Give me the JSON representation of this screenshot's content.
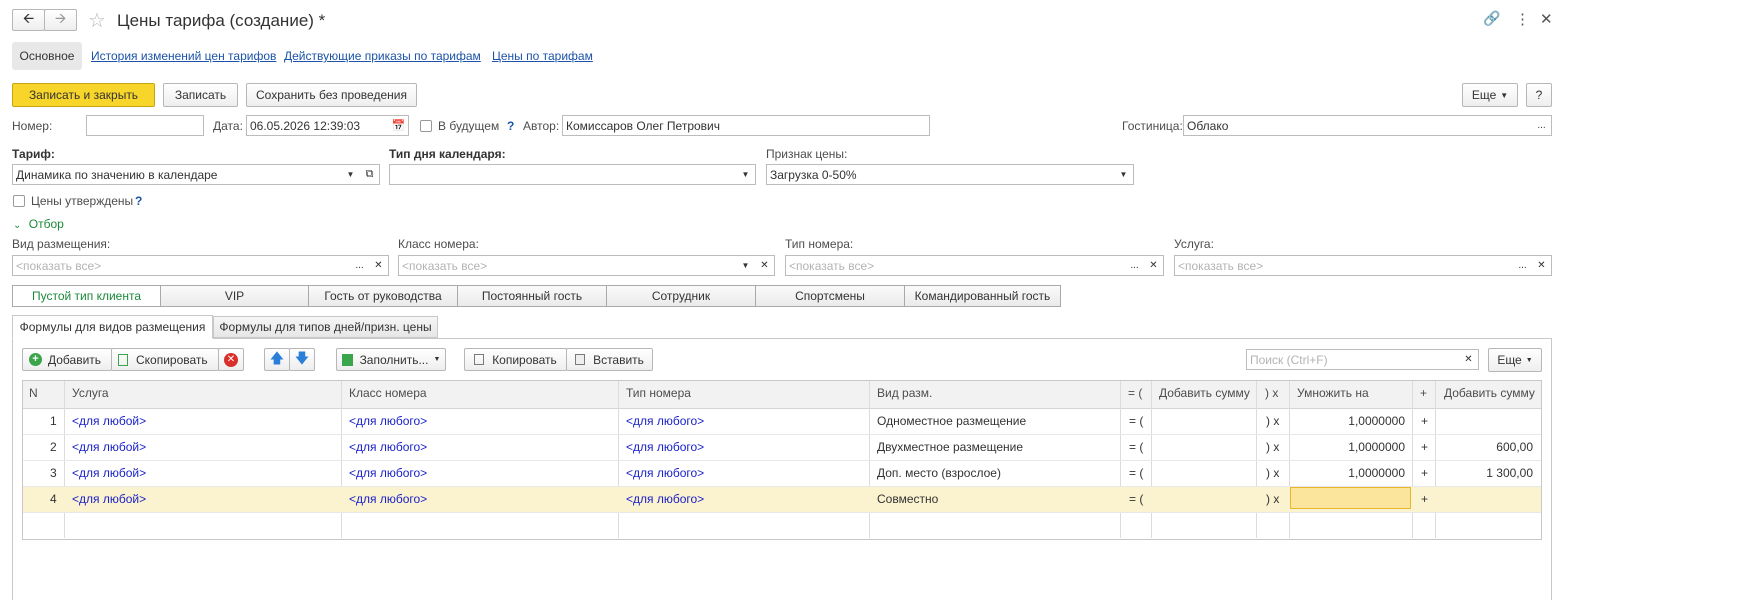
{
  "window": {
    "title": "Цены тарифа (создание) *"
  },
  "nav_tabs": [
    {
      "label": "Основное"
    },
    {
      "label": "История изменений цен тарифов"
    },
    {
      "label": "Действующие приказы по тарифам"
    },
    {
      "label": "Цены по тарифам"
    }
  ],
  "toolbar": {
    "write_close": "Записать и закрыть",
    "write": "Записать",
    "save_no_post": "Сохранить без проведения",
    "more": "Еще",
    "help": "?"
  },
  "header_fields": {
    "number_label": "Номер:",
    "number_value": "",
    "date_label": "Дата:",
    "date_value": "06.05.2026 12:39:03",
    "future_label": "В будущем",
    "future_q": "?",
    "author_label": "Автор:",
    "author_value": "Комиссаров Олег Петрович",
    "hotel_label": "Гостиница:",
    "hotel_value": "Облако"
  },
  "tariff_fields": {
    "tariff_label": "Тариф:",
    "tariff_value": "Динамика по значению в календаре",
    "day_type_label": "Тип дня календаря:",
    "day_type_value": "",
    "price_sign_label": "Признак цены:",
    "price_sign_value": "Загрузка 0-50%",
    "approved_label": "Цены утверждены",
    "approved_q": "?"
  },
  "filter": {
    "title": "Отбор",
    "placement_label": "Вид размещения:",
    "room_class_label": "Класс номера:",
    "room_type_label": "Тип номера:",
    "service_label": "Услуга:",
    "placeholder": "<показать все>"
  },
  "client_tabs": [
    {
      "label": "Пустой тип клиента"
    },
    {
      "label": "VIP"
    },
    {
      "label": "Гость от руководства"
    },
    {
      "label": "Постоянный гость"
    },
    {
      "label": "Сотрудник"
    },
    {
      "label": "Спортсмены"
    },
    {
      "label": "Командированный гость"
    }
  ],
  "formula_tabs": [
    {
      "label": "Формулы для видов размещения"
    },
    {
      "label": "Формулы для типов дней/призн. цены"
    }
  ],
  "table_toolbar": {
    "add": "Добавить",
    "copy": "Скопировать",
    "fill": "Заполнить...",
    "copy2": "Копировать",
    "paste": "Вставить",
    "search_placeholder": "Поиск (Ctrl+F)",
    "more": "Еще"
  },
  "table": {
    "columns": [
      "N",
      "Услуга",
      "Класс номера",
      "Тип номера",
      "Вид разм.",
      "= (",
      "Добавить сумму",
      ") x",
      "Умножить на",
      "+",
      "Добавить сумму"
    ],
    "rows": [
      {
        "n": "1",
        "service": "<для любой>",
        "room_class": "<для любого>",
        "room_type": "<для любого>",
        "placement": "Одноместное размещение",
        "op1": "= (",
        "add1": "",
        "op2": ") x",
        "mult": "1,0000000",
        "op3": "+",
        "add2": ""
      },
      {
        "n": "2",
        "service": "<для любой>",
        "room_class": "<для любого>",
        "room_type": "<для любого>",
        "placement": "Двухместное размещение",
        "op1": "= (",
        "add1": "",
        "op2": ") x",
        "mult": "1,0000000",
        "op3": "+",
        "add2": "600,00"
      },
      {
        "n": "3",
        "service": "<для любой>",
        "room_class": "<для любого>",
        "room_type": "<для любого>",
        "placement": "Доп. место (взрослое)",
        "op1": "= (",
        "add1": "",
        "op2": ") x",
        "mult": "1,0000000",
        "op3": "+",
        "add2": "1 300,00"
      },
      {
        "n": "4",
        "service": "<для любой>",
        "room_class": "<для любого>",
        "room_type": "<для любого>",
        "placement": "Совместно",
        "op1": "= (",
        "add1": "",
        "op2": ") x",
        "mult": "",
        "op3": "+",
        "add2": ""
      }
    ]
  },
  "colors": {
    "primary_button": "#f8d52a",
    "selected_row": "#fbf2cf",
    "link": "#1c53a8",
    "cell_value": "#1a22c8",
    "active_tab_text": "#1a8a3a"
  }
}
